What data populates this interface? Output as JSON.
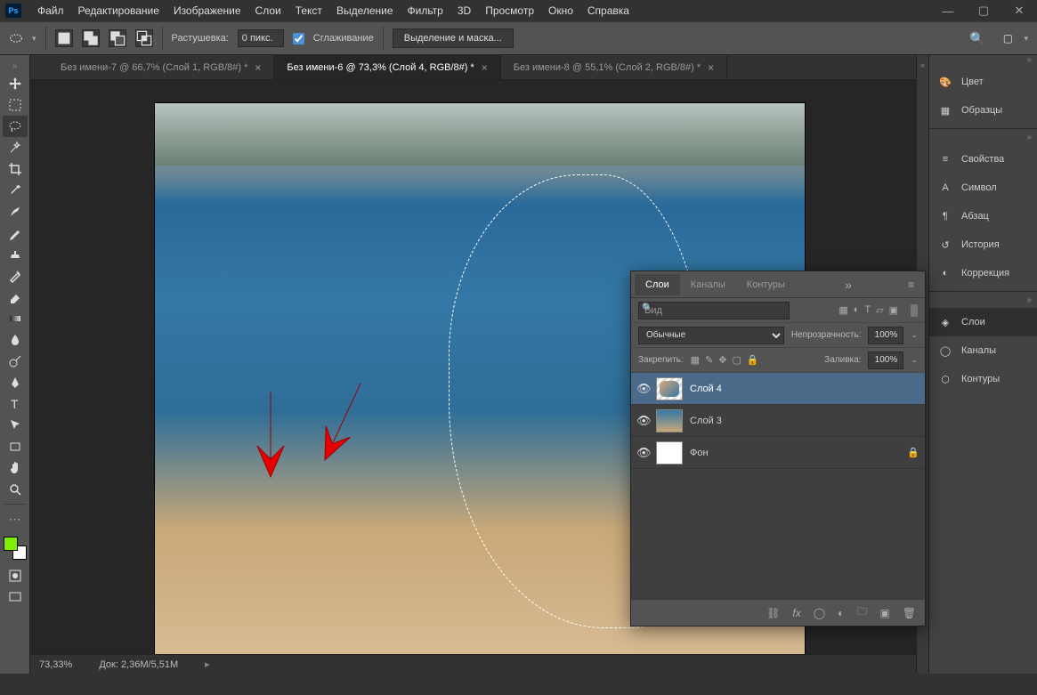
{
  "menu": [
    "Файл",
    "Редактирование",
    "Изображение",
    "Слои",
    "Текст",
    "Выделение",
    "Фильтр",
    "3D",
    "Просмотр",
    "Окно",
    "Справка"
  ],
  "options": {
    "feather_label": "Растушевка:",
    "feather_value": "0 пикс.",
    "aa_label": "Сглаживание",
    "mask_btn": "Выделение и маска..."
  },
  "tabs": [
    {
      "label": "Без имени-7 @ 66,7% (Слой 1, RGB/8#) *"
    },
    {
      "label": "Без имени-6 @ 73,3% (Слой 4, RGB/8#) *"
    },
    {
      "label": "Без имени-8 @ 55,1% (Слой 2, RGB/8#) *"
    }
  ],
  "active_tab": 1,
  "layers_panel": {
    "tabs": [
      "Слои",
      "Каналы",
      "Контуры"
    ],
    "search_placeholder": "Вид",
    "blend_mode": "Обычные",
    "opacity_label": "Непрозрачность:",
    "opacity_value": "100%",
    "lock_label": "Закрепить:",
    "fill_label": "Заливка:",
    "fill_value": "100%",
    "layers": [
      {
        "name": "Слой 4",
        "thumb": "thumb-4",
        "selected": true,
        "locked": false
      },
      {
        "name": "Слой 3",
        "thumb": "thumb-3",
        "selected": false,
        "locked": false
      },
      {
        "name": "Фон",
        "thumb": "",
        "selected": false,
        "locked": true
      }
    ]
  },
  "right_panels": [
    [
      {
        "icon": "palette",
        "label": "Цвет"
      },
      {
        "icon": "swatches",
        "label": "Образцы"
      }
    ],
    [
      {
        "icon": "prop",
        "label": "Свойства"
      },
      {
        "icon": "char",
        "label": "Символ"
      },
      {
        "icon": "para",
        "label": "Абзац"
      },
      {
        "icon": "hist",
        "label": "История"
      },
      {
        "icon": "adj",
        "label": "Коррекция"
      }
    ],
    [
      {
        "icon": "layers",
        "label": "Слои"
      },
      {
        "icon": "channels",
        "label": "Каналы"
      },
      {
        "icon": "paths",
        "label": "Контуры"
      }
    ]
  ],
  "selected_right_panel": "Слои",
  "status": {
    "zoom": "73,33%",
    "doc_label": "Док:",
    "doc_value": "2,36M/5,51M"
  }
}
